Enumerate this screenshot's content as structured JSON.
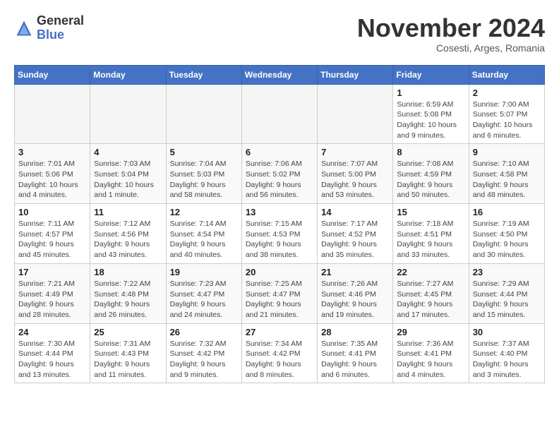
{
  "header": {
    "logo_general": "General",
    "logo_blue": "Blue",
    "month_title": "November 2024",
    "subtitle": "Cosesti, Arges, Romania"
  },
  "columns": [
    "Sunday",
    "Monday",
    "Tuesday",
    "Wednesday",
    "Thursday",
    "Friday",
    "Saturday"
  ],
  "weeks": [
    [
      {
        "day": "",
        "info": ""
      },
      {
        "day": "",
        "info": ""
      },
      {
        "day": "",
        "info": ""
      },
      {
        "day": "",
        "info": ""
      },
      {
        "day": "",
        "info": ""
      },
      {
        "day": "1",
        "info": "Sunrise: 6:59 AM\nSunset: 5:08 PM\nDaylight: 10 hours and 9 minutes."
      },
      {
        "day": "2",
        "info": "Sunrise: 7:00 AM\nSunset: 5:07 PM\nDaylight: 10 hours and 6 minutes."
      }
    ],
    [
      {
        "day": "3",
        "info": "Sunrise: 7:01 AM\nSunset: 5:06 PM\nDaylight: 10 hours and 4 minutes."
      },
      {
        "day": "4",
        "info": "Sunrise: 7:03 AM\nSunset: 5:04 PM\nDaylight: 10 hours and 1 minute."
      },
      {
        "day": "5",
        "info": "Sunrise: 7:04 AM\nSunset: 5:03 PM\nDaylight: 9 hours and 58 minutes."
      },
      {
        "day": "6",
        "info": "Sunrise: 7:06 AM\nSunset: 5:02 PM\nDaylight: 9 hours and 56 minutes."
      },
      {
        "day": "7",
        "info": "Sunrise: 7:07 AM\nSunset: 5:00 PM\nDaylight: 9 hours and 53 minutes."
      },
      {
        "day": "8",
        "info": "Sunrise: 7:08 AM\nSunset: 4:59 PM\nDaylight: 9 hours and 50 minutes."
      },
      {
        "day": "9",
        "info": "Sunrise: 7:10 AM\nSunset: 4:58 PM\nDaylight: 9 hours and 48 minutes."
      }
    ],
    [
      {
        "day": "10",
        "info": "Sunrise: 7:11 AM\nSunset: 4:57 PM\nDaylight: 9 hours and 45 minutes."
      },
      {
        "day": "11",
        "info": "Sunrise: 7:12 AM\nSunset: 4:56 PM\nDaylight: 9 hours and 43 minutes."
      },
      {
        "day": "12",
        "info": "Sunrise: 7:14 AM\nSunset: 4:54 PM\nDaylight: 9 hours and 40 minutes."
      },
      {
        "day": "13",
        "info": "Sunrise: 7:15 AM\nSunset: 4:53 PM\nDaylight: 9 hours and 38 minutes."
      },
      {
        "day": "14",
        "info": "Sunrise: 7:17 AM\nSunset: 4:52 PM\nDaylight: 9 hours and 35 minutes."
      },
      {
        "day": "15",
        "info": "Sunrise: 7:18 AM\nSunset: 4:51 PM\nDaylight: 9 hours and 33 minutes."
      },
      {
        "day": "16",
        "info": "Sunrise: 7:19 AM\nSunset: 4:50 PM\nDaylight: 9 hours and 30 minutes."
      }
    ],
    [
      {
        "day": "17",
        "info": "Sunrise: 7:21 AM\nSunset: 4:49 PM\nDaylight: 9 hours and 28 minutes."
      },
      {
        "day": "18",
        "info": "Sunrise: 7:22 AM\nSunset: 4:48 PM\nDaylight: 9 hours and 26 minutes."
      },
      {
        "day": "19",
        "info": "Sunrise: 7:23 AM\nSunset: 4:47 PM\nDaylight: 9 hours and 24 minutes."
      },
      {
        "day": "20",
        "info": "Sunrise: 7:25 AM\nSunset: 4:47 PM\nDaylight: 9 hours and 21 minutes."
      },
      {
        "day": "21",
        "info": "Sunrise: 7:26 AM\nSunset: 4:46 PM\nDaylight: 9 hours and 19 minutes."
      },
      {
        "day": "22",
        "info": "Sunrise: 7:27 AM\nSunset: 4:45 PM\nDaylight: 9 hours and 17 minutes."
      },
      {
        "day": "23",
        "info": "Sunrise: 7:29 AM\nSunset: 4:44 PM\nDaylight: 9 hours and 15 minutes."
      }
    ],
    [
      {
        "day": "24",
        "info": "Sunrise: 7:30 AM\nSunset: 4:44 PM\nDaylight: 9 hours and 13 minutes."
      },
      {
        "day": "25",
        "info": "Sunrise: 7:31 AM\nSunset: 4:43 PM\nDaylight: 9 hours and 11 minutes."
      },
      {
        "day": "26",
        "info": "Sunrise: 7:32 AM\nSunset: 4:42 PM\nDaylight: 9 hours and 9 minutes."
      },
      {
        "day": "27",
        "info": "Sunrise: 7:34 AM\nSunset: 4:42 PM\nDaylight: 9 hours and 8 minutes."
      },
      {
        "day": "28",
        "info": "Sunrise: 7:35 AM\nSunset: 4:41 PM\nDaylight: 9 hours and 6 minutes."
      },
      {
        "day": "29",
        "info": "Sunrise: 7:36 AM\nSunset: 4:41 PM\nDaylight: 9 hours and 4 minutes."
      },
      {
        "day": "30",
        "info": "Sunrise: 7:37 AM\nSunset: 4:40 PM\nDaylight: 9 hours and 3 minutes."
      }
    ]
  ]
}
